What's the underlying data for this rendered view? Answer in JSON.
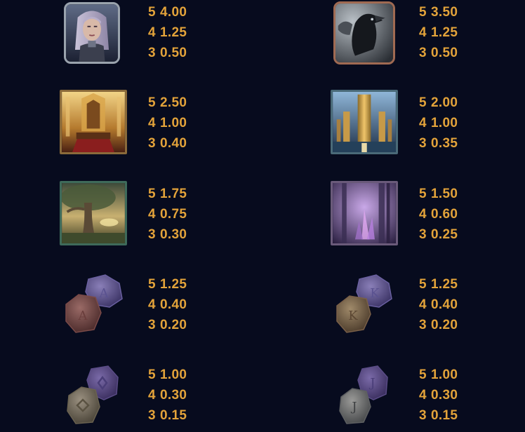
{
  "paytable": {
    "left": [
      {
        "symbol": "warrior-woman-icon",
        "pays": [
          {
            "count": "5",
            "value": "4.00"
          },
          {
            "count": "4",
            "value": "1.25"
          },
          {
            "count": "3",
            "value": "0.50"
          }
        ]
      },
      {
        "symbol": "golden-throne-icon",
        "pays": [
          {
            "count": "5",
            "value": "2.50"
          },
          {
            "count": "4",
            "value": "1.00"
          },
          {
            "count": "3",
            "value": "0.40"
          }
        ]
      },
      {
        "symbol": "world-tree-icon",
        "pays": [
          {
            "count": "5",
            "value": "1.75"
          },
          {
            "count": "4",
            "value": "0.75"
          },
          {
            "count": "3",
            "value": "0.30"
          }
        ]
      },
      {
        "symbol": "rune-a-stones-icon",
        "pays": [
          {
            "count": "5",
            "value": "1.25"
          },
          {
            "count": "4",
            "value": "0.40"
          },
          {
            "count": "3",
            "value": "0.20"
          }
        ]
      },
      {
        "symbol": "rune-q-stones-icon",
        "pays": [
          {
            "count": "5",
            "value": "1.00"
          },
          {
            "count": "4",
            "value": "0.30"
          },
          {
            "count": "3",
            "value": "0.15"
          }
        ]
      }
    ],
    "right": [
      {
        "symbol": "raven-icon",
        "pays": [
          {
            "count": "5",
            "value": "3.50"
          },
          {
            "count": "4",
            "value": "1.25"
          },
          {
            "count": "3",
            "value": "0.50"
          }
        ]
      },
      {
        "symbol": "golden-citadel-icon",
        "pays": [
          {
            "count": "5",
            "value": "2.00"
          },
          {
            "count": "4",
            "value": "1.00"
          },
          {
            "count": "3",
            "value": "0.35"
          }
        ]
      },
      {
        "symbol": "crystal-forest-icon",
        "pays": [
          {
            "count": "5",
            "value": "1.50"
          },
          {
            "count": "4",
            "value": "0.60"
          },
          {
            "count": "3",
            "value": "0.25"
          }
        ]
      },
      {
        "symbol": "rune-k-stones-icon",
        "pays": [
          {
            "count": "5",
            "value": "1.25"
          },
          {
            "count": "4",
            "value": "0.40"
          },
          {
            "count": "3",
            "value": "0.20"
          }
        ]
      },
      {
        "symbol": "rune-j-stones-icon",
        "pays": [
          {
            "count": "5",
            "value": "1.00"
          },
          {
            "count": "4",
            "value": "0.30"
          },
          {
            "count": "3",
            "value": "0.15"
          }
        ]
      }
    ]
  },
  "rune_letters": {
    "a": "A",
    "k": "K",
    "j": "J"
  },
  "colors": {
    "background": "#070b1e",
    "payout_text": "#e3a33a"
  }
}
